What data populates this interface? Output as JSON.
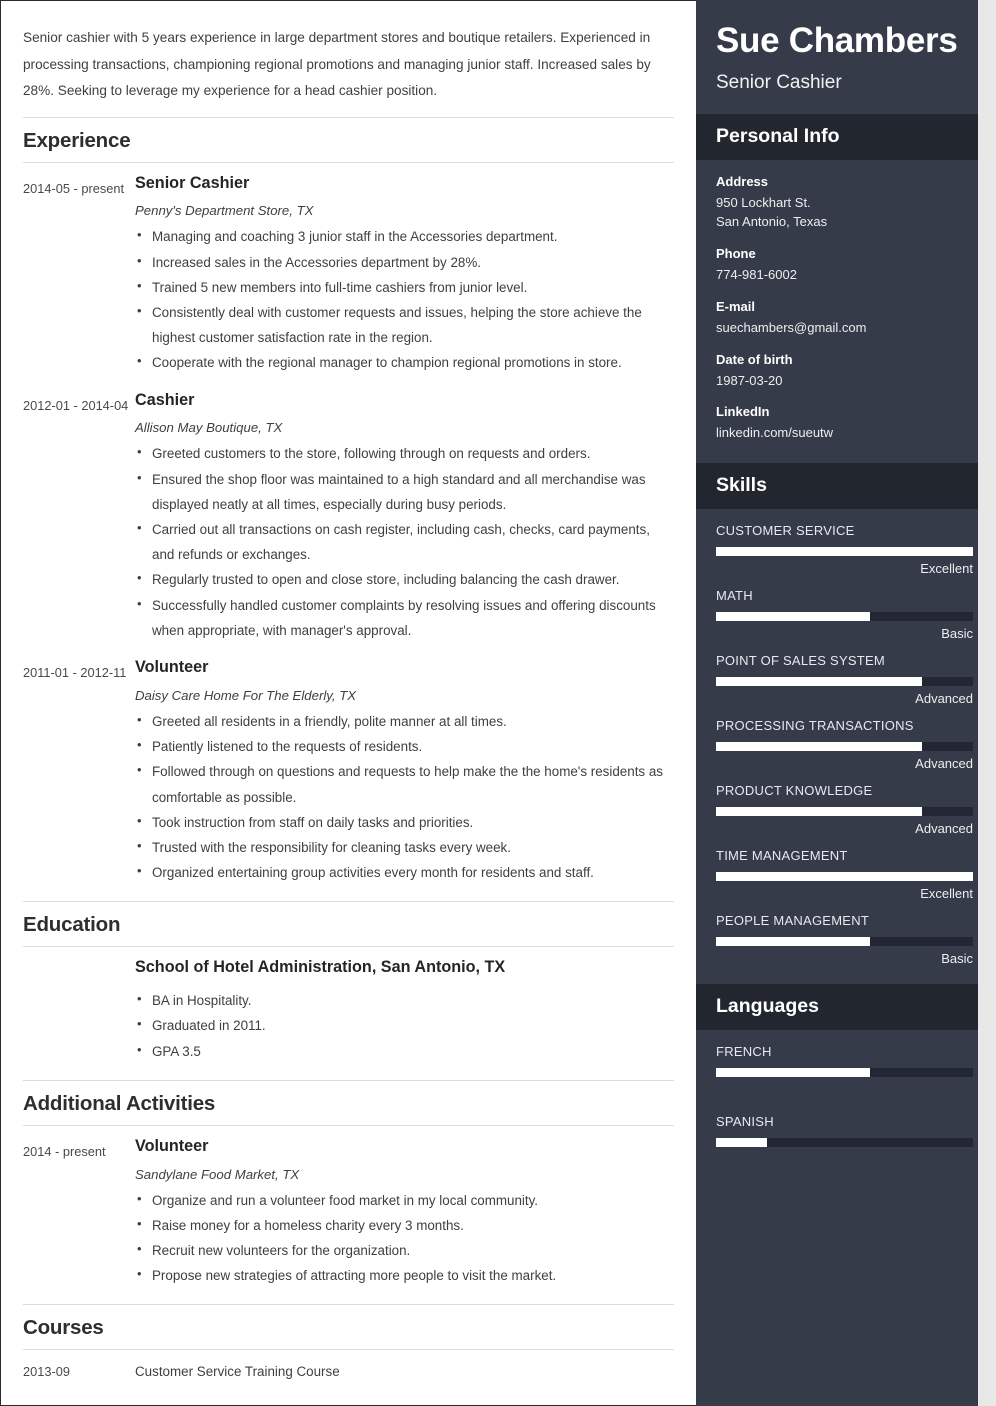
{
  "summary": "Senior cashier with 5 years experience in large department stores and boutique retailers. Experienced in processing transactions, championing regional promotions and managing junior staff. Increased sales by 28%. Seeking to leverage my experience for a head cashier position.",
  "sections": {
    "experience_title": "Experience",
    "education_title": "Education",
    "activities_title": "Additional Activities",
    "courses_title": "Courses"
  },
  "experience": [
    {
      "dates": "2014-05 - present",
      "title": "Senior Cashier",
      "subtitle": "Penny's Department Store, TX",
      "bullets": [
        "Managing and coaching 3 junior staff in the Accessories department.",
        "Increased sales in the Accessories department by 28%.",
        "Trained 5 new members into full-time cashiers from junior level.",
        "Consistently deal with customer requests and issues, helping the store achieve the highest customer satisfaction rate in the region.",
        "Cooperate with the regional manager to champion regional promotions in store."
      ]
    },
    {
      "dates": "2012-01 - 2014-04",
      "title": "Cashier",
      "subtitle": "Allison May Boutique, TX",
      "bullets": [
        "Greeted customers to the store, following through on requests and orders.",
        "Ensured the shop floor was maintained to a high standard and all merchandise was displayed neatly at all times, especially during busy periods.",
        "Carried out all transactions on cash register, including cash, checks, card payments, and refunds or exchanges.",
        "Regularly trusted to open and close store, including balancing the cash drawer.",
        "Successfully handled customer complaints by resolving issues and offering discounts when appropriate, with manager's approval."
      ]
    },
    {
      "dates": "2011-01 - 2012-11",
      "title": "Volunteer",
      "subtitle": "Daisy Care Home For The Elderly, TX",
      "bullets": [
        "Greeted all residents in a friendly, polite manner at all times.",
        "Patiently listened to the requests of residents.",
        "Followed through on questions and requests to help make the the home's residents as comfortable as possible.",
        "Took instruction from staff on daily tasks and priorities.",
        "Trusted with the responsibility for cleaning tasks every week.",
        "Organized entertaining group activities every month for residents and staff."
      ]
    }
  ],
  "education": [
    {
      "dates": "",
      "title": "School of Hotel Administration, San Antonio, TX",
      "subtitle": "",
      "bullets": [
        "BA in Hospitality.",
        "Graduated in 2011.",
        "GPA 3.5"
      ]
    }
  ],
  "activities": [
    {
      "dates": "2014 - present",
      "title": "Volunteer",
      "subtitle": "Sandylane Food Market, TX",
      "bullets": [
        "Organize and run a volunteer food market in my local community.",
        "Raise money for a homeless charity every 3 months.",
        "Recruit new volunteers for the organization.",
        "Propose new strategies of attracting more people to visit the market."
      ]
    }
  ],
  "courses": [
    {
      "date": "2013-09",
      "name": "Customer Service Training Course"
    }
  ],
  "sidebar": {
    "name": "Sue Chambers",
    "role": "Senior Cashier",
    "personal_info_title": "Personal Info",
    "skills_title": "Skills",
    "languages_title": "Languages",
    "personal_info": [
      {
        "label": "Address",
        "value": "950 Lockhart St.",
        "value2": "San Antonio, Texas"
      },
      {
        "label": "Phone",
        "value": "774-981-6002",
        "value2": ""
      },
      {
        "label": "E-mail",
        "value": "suechambers@gmail.com",
        "value2": ""
      },
      {
        "label": "Date of birth",
        "value": "1987-03-20",
        "value2": ""
      },
      {
        "label": "LinkedIn",
        "value": "linkedin.com/sueutw",
        "value2": ""
      }
    ],
    "skills": [
      {
        "name": "CUSTOMER SERVICE",
        "level": "Excellent",
        "pct": 100
      },
      {
        "name": "MATH",
        "level": "Basic",
        "pct": 60
      },
      {
        "name": "POINT OF SALES SYSTEM",
        "level": "Advanced",
        "pct": 80
      },
      {
        "name": "PROCESSING TRANSACTIONS",
        "level": "Advanced",
        "pct": 80
      },
      {
        "name": "PRODUCT KNOWLEDGE",
        "level": "Advanced",
        "pct": 80
      },
      {
        "name": "TIME MANAGEMENT",
        "level": "Excellent",
        "pct": 100
      },
      {
        "name": "PEOPLE MANAGEMENT",
        "level": "Basic",
        "pct": 60
      }
    ],
    "languages": [
      {
        "name": "FRENCH",
        "level": "",
        "pct": 60
      },
      {
        "name": "SPANISH",
        "level": "",
        "pct": 20
      }
    ]
  },
  "colors": {
    "sidebar_bg": "#353b49",
    "sidebar_head_bg": "#22262f",
    "bar_track": "#222733",
    "bar_fill": "#ffffff",
    "page_bg": "#ffffff",
    "rule": "#dcdcdc"
  }
}
